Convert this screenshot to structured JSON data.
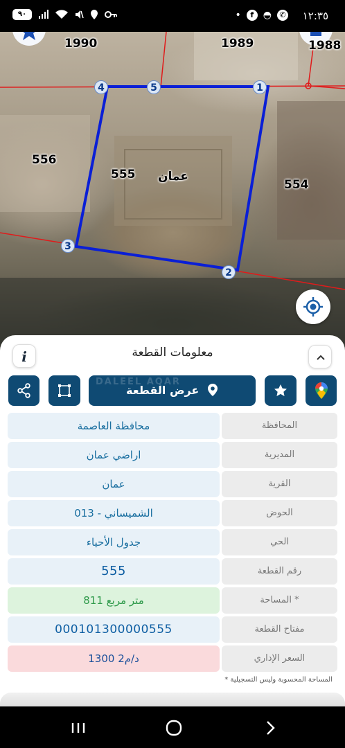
{
  "status_bar": {
    "time": "١٢:٣٥",
    "battery": "٩٠",
    "right_icons": [
      "dot-icon",
      "facebook-icon",
      "bird-icon",
      "whatsapp-icon"
    ],
    "left_icons": [
      "battery-icon",
      "signal-icon",
      "wifi-icon",
      "mute-icon",
      "location-icon",
      "key-icon"
    ]
  },
  "map": {
    "parcel_numbers": {
      "p1990": "1990",
      "p1989": "1989",
      "p1988": "1988",
      "p556": "556",
      "p555": "555",
      "p554": "554"
    },
    "area_name": "عمان",
    "vertices": {
      "v1": "1",
      "v2": "2",
      "v3": "3",
      "v4": "4",
      "v5": "5"
    },
    "boundary_color": "#0a1fd6",
    "neighbor_line_color": "#e01b1b"
  },
  "sheet": {
    "title": "معلومات القطعة",
    "info_label": "i",
    "show_parcel_label": "عرض القطعة",
    "watermark": "DALEEL AQAR",
    "rows": [
      {
        "label": "المحافظة",
        "value": "محافظة العاصمة"
      },
      {
        "label": "المديرية",
        "value": "اراضي عمان"
      },
      {
        "label": "القرية",
        "value": "عمان"
      },
      {
        "label": "الحوض",
        "value": "الشميساني - 013"
      },
      {
        "label": "الحي",
        "value": "جدول الأحياء"
      },
      {
        "label": "رقم القطعة",
        "value": "555"
      },
      {
        "label": "المساحة *",
        "value": "811  متر مربع"
      },
      {
        "label": "مفتاح القطعة",
        "value": "000101300000555"
      },
      {
        "label": "السعر الإداري",
        "value": "1300 د/م2"
      }
    ],
    "footnote": "* المساحة المحسوبة وليس التسجيلية"
  },
  "colors": {
    "primary": "#0f4a73",
    "value_text": "#1a6fa0",
    "area_bg": "#ddf3dd",
    "price_bg": "#fadadc"
  }
}
